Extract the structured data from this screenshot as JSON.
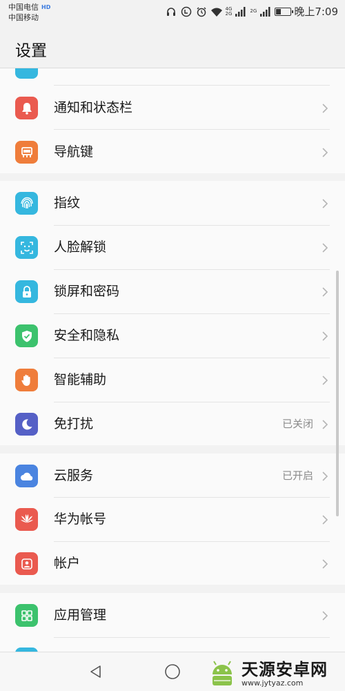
{
  "status_bar": {
    "carrier_1": "中国电信",
    "carrier_2": "中国移动",
    "hd_badge": "HD",
    "network_1": "4G",
    "network_2": "2G",
    "network_3": "2G",
    "time": "晚上7:09",
    "battery_level": 0.35
  },
  "header": {
    "title": "设置"
  },
  "items": [
    {
      "label": "通知和状态栏",
      "value": "",
      "icon": "bell-icon",
      "color": "#ea5a4f"
    },
    {
      "label": "导航键",
      "value": "",
      "icon": "navigation-key-icon",
      "color": "#ef7d3b"
    },
    {
      "label": "指纹",
      "value": "",
      "icon": "fingerprint-icon",
      "color": "#35b7df"
    },
    {
      "label": "人脸解锁",
      "value": "",
      "icon": "face-unlock-icon",
      "color": "#35b7df"
    },
    {
      "label": "锁屏和密码",
      "value": "",
      "icon": "lock-icon",
      "color": "#35b7df"
    },
    {
      "label": "安全和隐私",
      "value": "",
      "icon": "shield-icon",
      "color": "#3cc26d"
    },
    {
      "label": "智能辅助",
      "value": "",
      "icon": "hand-icon",
      "color": "#ef7d3b"
    },
    {
      "label": "免打扰",
      "value": "已关闭",
      "icon": "moon-icon",
      "color": "#5560c6"
    },
    {
      "label": "云服务",
      "value": "已开启",
      "icon": "cloud-icon",
      "color": "#4a84e0"
    },
    {
      "label": "华为帐号",
      "value": "",
      "icon": "huawei-logo-icon",
      "color": "#ea5a4f"
    },
    {
      "label": "帐户",
      "value": "",
      "icon": "account-icon",
      "color": "#ea5a4f"
    },
    {
      "label": "应用管理",
      "value": "",
      "icon": "app-grid-icon",
      "color": "#3cc26d"
    }
  ],
  "partial_top_icon_color": "#35b7df",
  "partial_bottom_icon_color": "#35b7df",
  "watermark": {
    "title": "天源安卓网",
    "url": "www.jytyaz.com"
  }
}
